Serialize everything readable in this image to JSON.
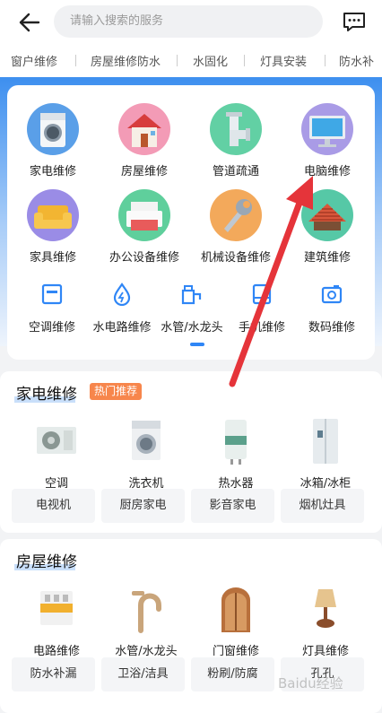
{
  "header": {
    "search_placeholder": "请输入搜索的服务"
  },
  "tabs": [
    "窗户维修",
    "房屋维修防水",
    "水固化",
    "灯具安装",
    "防水补"
  ],
  "categories": [
    {
      "label": "家电维修",
      "icon": "washing-machine-icon"
    },
    {
      "label": "房屋维修",
      "icon": "house-icon"
    },
    {
      "label": "管道疏通",
      "icon": "pipe-icon"
    },
    {
      "label": "电脑维修",
      "icon": "computer-icon"
    },
    {
      "label": "家具维修",
      "icon": "sofa-icon"
    },
    {
      "label": "办公设备维修",
      "icon": "printer-icon"
    },
    {
      "label": "机械设备维修",
      "icon": "wrench-icon"
    },
    {
      "label": "建筑维修",
      "icon": "roof-icon"
    }
  ],
  "small_categories": [
    {
      "label": "空调维修",
      "icon": "air-conditioner-icon"
    },
    {
      "label": "水电路维修",
      "icon": "water-drop-icon"
    },
    {
      "label": "水管/水龙头",
      "icon": "faucet-icon"
    },
    {
      "label": "手机维修",
      "icon": "phone-icon"
    },
    {
      "label": "数码维修",
      "icon": "camera-icon"
    }
  ],
  "appliance": {
    "title": "家电维修",
    "badge": "热门推荐",
    "items": [
      "空调",
      "洗衣机",
      "热水器",
      "冰箱/冰柜"
    ],
    "chips": [
      "电视机",
      "厨房家电",
      "影音家电",
      "烟机灶具"
    ]
  },
  "house": {
    "title": "房屋维修",
    "items": [
      "电路维修",
      "水管/水龙头",
      "门窗维修",
      "灯具维修"
    ],
    "chips": [
      "防水补漏",
      "卫浴/洁具",
      "粉刷/防腐",
      "孔孔"
    ]
  },
  "watermark": "Baidu经验",
  "colors": {
    "accent": "#2f86f6",
    "badge": "#f7864c",
    "arrow": "#e5343a"
  }
}
